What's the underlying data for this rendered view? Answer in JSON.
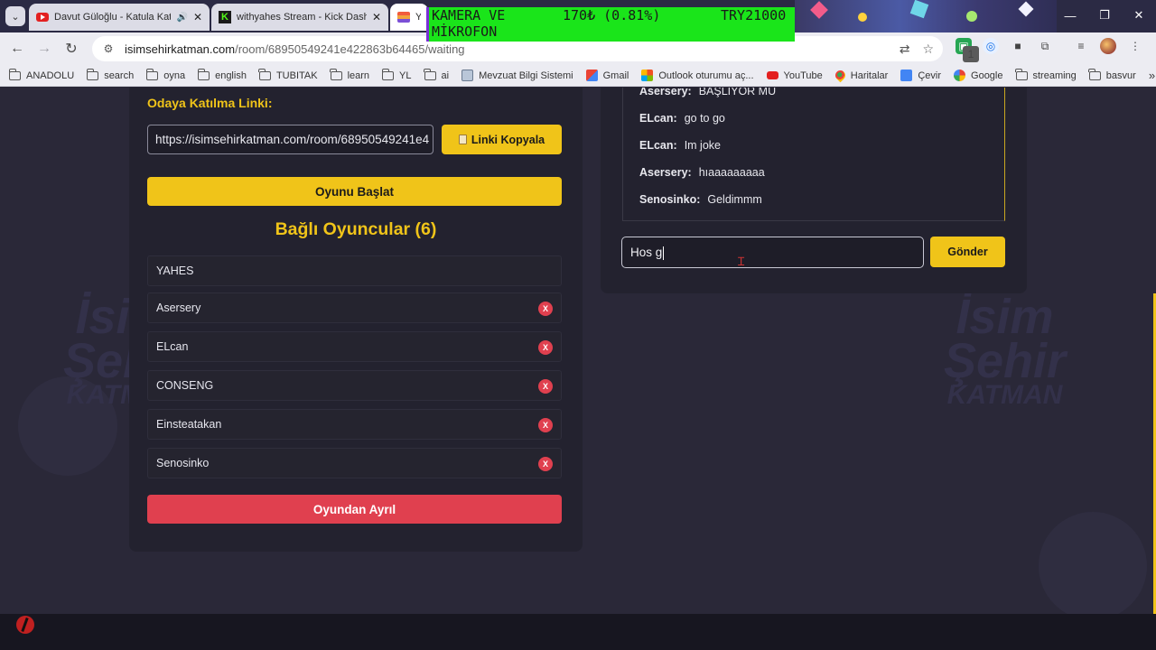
{
  "browser": {
    "tabs": [
      {
        "title": "Davut Güloğlu - Katula Katula",
        "favicon": "youtube-icon",
        "audio": true
      },
      {
        "title": "withyahes Stream - Kick Dashboard",
        "favicon": "kick-icon",
        "audio": false
      },
      {
        "title": "YA",
        "favicon": "site-icon",
        "audio": false
      }
    ],
    "overlay": {
      "line1": "KAMERA VE",
      "amount": "170₺ (0.81%)",
      "goal": "TRY21000",
      "line2": "MİKROFON"
    },
    "url": {
      "host": "isimsehirkatman.com",
      "path": "/room/68950549241e422863b64465/waiting"
    },
    "extension_badge": "1",
    "bookmarks": [
      {
        "label": "ANADOLU",
        "icon": "folder-icon"
      },
      {
        "label": "search",
        "icon": "folder-icon"
      },
      {
        "label": "oyna",
        "icon": "folder-icon"
      },
      {
        "label": "english",
        "icon": "folder-icon"
      },
      {
        "label": "TUBITAK",
        "icon": "folder-icon"
      },
      {
        "label": "learn",
        "icon": "folder-icon"
      },
      {
        "label": "YL",
        "icon": "folder-icon"
      },
      {
        "label": "ai",
        "icon": "folder-icon"
      },
      {
        "label": "Mevzuat Bilgi Sistemi",
        "icon": "mevzuat-icon"
      },
      {
        "label": "Gmail",
        "icon": "gmail-icon"
      },
      {
        "label": "Outlook oturumu aç...",
        "icon": "microsoft-icon"
      },
      {
        "label": "YouTube",
        "icon": "youtube-icon"
      },
      {
        "label": "Haritalar",
        "icon": "maps-icon"
      },
      {
        "label": "Çevir",
        "icon": "translate-icon"
      },
      {
        "label": "Google",
        "icon": "google-icon"
      },
      {
        "label": "streaming",
        "icon": "folder-icon"
      },
      {
        "label": "basvur",
        "icon": "folder-icon"
      }
    ]
  },
  "room": {
    "join_label": "Odaya Katılma Linki:",
    "join_link": "https://isimsehirkatman.com/room/68950549241e4",
    "copy_button": "Linki Kopyala",
    "start_button": "Oyunu Başlat",
    "players_title": "Bağlı Oyuncular (6)",
    "players": [
      {
        "name": "YAHES",
        "kickable": false
      },
      {
        "name": "Asersery",
        "kickable": true
      },
      {
        "name": "ELcan",
        "kickable": true
      },
      {
        "name": "CONSENG",
        "kickable": true
      },
      {
        "name": "Einsteatakan",
        "kickable": true
      },
      {
        "name": "Senosinko",
        "kickable": true
      }
    ],
    "kick_label": "X",
    "leave_button": "Oyundan Ayrıl"
  },
  "chat": {
    "messages": [
      {
        "user": "Asersery:",
        "text": "BAŞLIYOR MU"
      },
      {
        "user": "ELcan:",
        "text": "go to go"
      },
      {
        "user": "ELcan:",
        "text": "Im joke"
      },
      {
        "user": "Asersery:",
        "text": "hıaaaaaaaaa"
      },
      {
        "user": "Senosinko:",
        "text": "Geldimmm"
      }
    ],
    "input_value": "Hos g",
    "send_button": "Gönder"
  },
  "background": {
    "logo_line1": "İsim",
    "logo_line2": "Şehir",
    "logo_line3": "KATMAN"
  },
  "colors": {
    "accent": "#f0c419",
    "danger": "#e0404f",
    "panel": "#23222f",
    "page_bg": "#2a2838"
  }
}
